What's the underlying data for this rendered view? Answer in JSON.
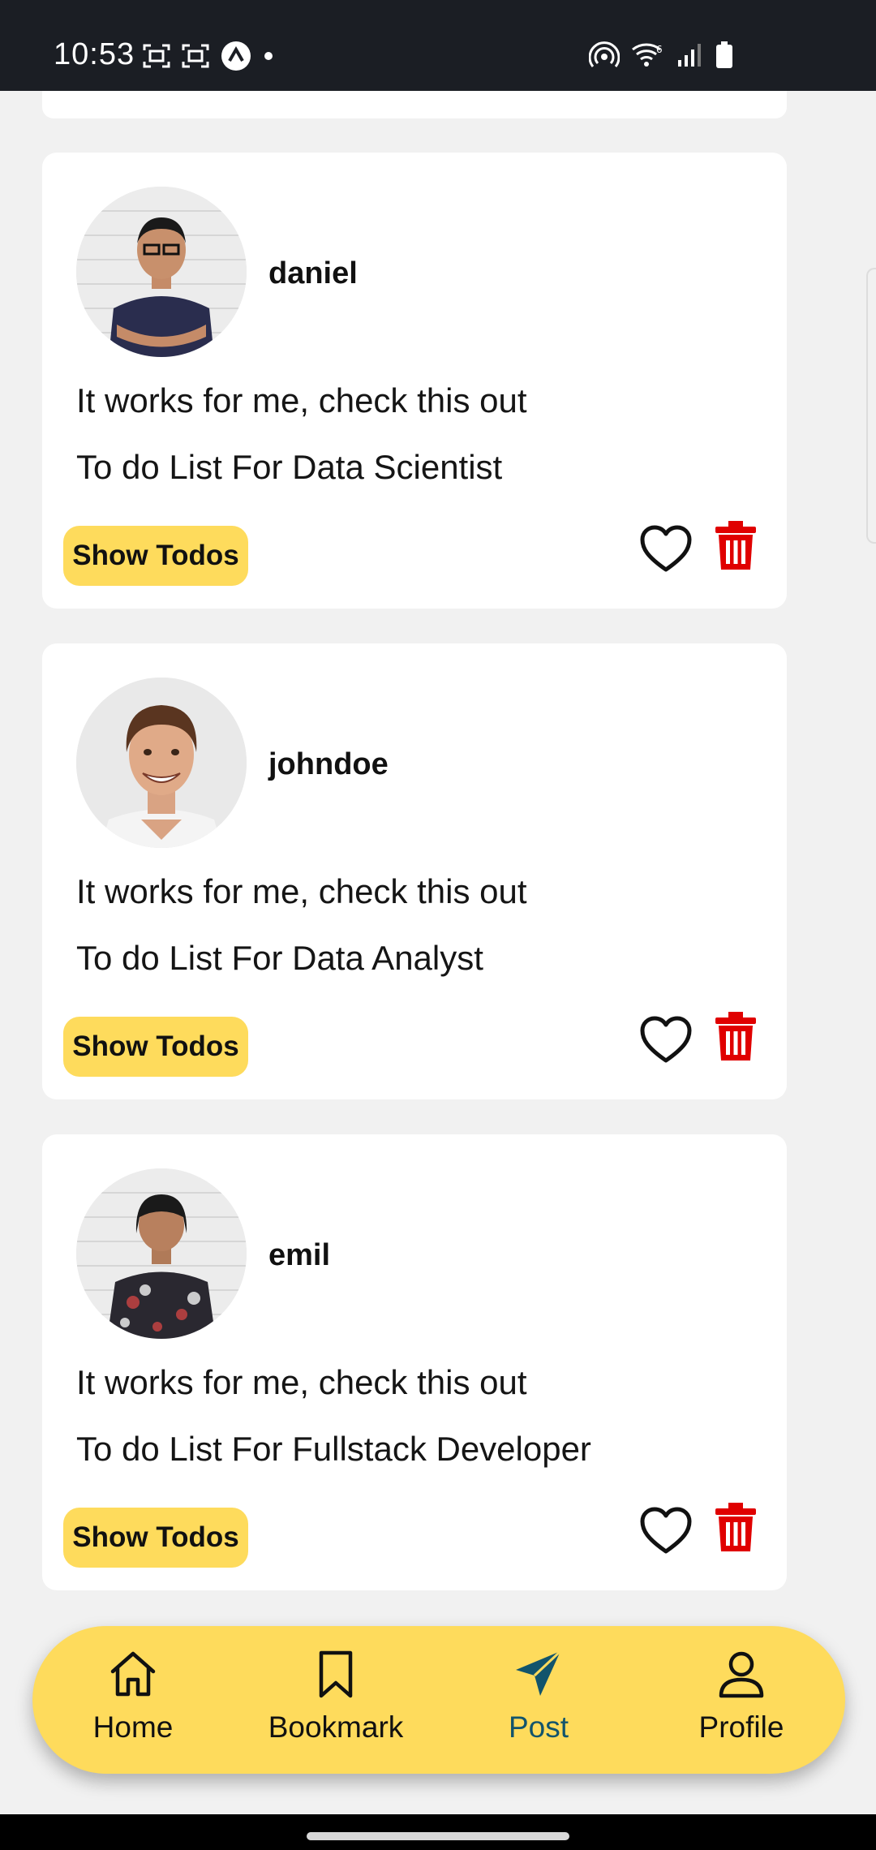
{
  "status_bar": {
    "time": "10:53",
    "left_icons": [
      "screenshot-icon",
      "screenshot-icon",
      "app-notification-icon",
      "dot-icon"
    ],
    "right_icons": [
      "hotspot-icon",
      "wifi-icon",
      "signal-icon",
      "battery-icon"
    ]
  },
  "posts": [
    {
      "username": "daniel",
      "line1": "It works for me, check this out",
      "line2": "To do List For Data Scientist",
      "button_label": "Show Todos"
    },
    {
      "username": "johndoe",
      "line1": "It works for me, check this out",
      "line2": "To do List For Data Analyst",
      "button_label": "Show Todos"
    },
    {
      "username": "emil",
      "line1": "It works for me, check this out",
      "line2": "To do List For Fullstack Developer",
      "button_label": "Show Todos"
    }
  ],
  "bottom_nav": {
    "items": [
      {
        "label": "Home",
        "icon": "home-icon"
      },
      {
        "label": "Bookmark",
        "icon": "bookmark-icon"
      },
      {
        "label": "Post",
        "icon": "send-icon",
        "active": true
      },
      {
        "label": "Profile",
        "icon": "profile-icon"
      }
    ]
  },
  "colors": {
    "accent_yellow": "#fedb5c",
    "delete_red": "#e00000",
    "active_nav": "#12546c",
    "background": "#f1f1f1"
  }
}
